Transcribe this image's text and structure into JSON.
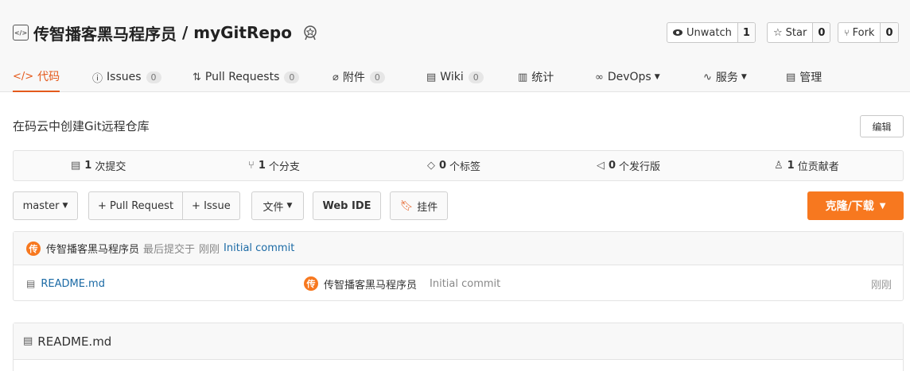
{
  "repo": {
    "owner": "传智播客黑马程序员",
    "separator": " / ",
    "name": "myGitRepo",
    "icon": "repo-code-icon"
  },
  "actions": {
    "unwatch": {
      "label": "Unwatch",
      "count": "1"
    },
    "star": {
      "label": "Star",
      "count": "0"
    },
    "fork": {
      "label": "Fork",
      "count": "0"
    }
  },
  "nav": {
    "code": "代码",
    "issues": {
      "label": "Issues",
      "count": "0"
    },
    "pulls": {
      "label": "Pull Requests",
      "count": "0"
    },
    "attach": {
      "label": "附件",
      "count": "0"
    },
    "wiki": {
      "label": "Wiki",
      "count": "0"
    },
    "stats": "统计",
    "devops": "DevOps",
    "service": "服务",
    "manage": "管理"
  },
  "description": "在码云中创建Git远程仓库",
  "edit_label": "编辑",
  "stats": {
    "commits": {
      "num": "1",
      "label": "次提交"
    },
    "branches": {
      "num": "1",
      "label": "个分支"
    },
    "tags": {
      "num": "0",
      "label": "个标签"
    },
    "releases": {
      "num": "0",
      "label": "个发行版"
    },
    "contributors": {
      "num": "1",
      "label": "位贡献者"
    }
  },
  "toolbar": {
    "branch": "master",
    "pull_request": "+ Pull Request",
    "issue": "+ Issue",
    "file": "文件",
    "web_ide": "Web IDE",
    "widget": "挂件",
    "clone": "克隆/下载"
  },
  "last_commit": {
    "avatar": "传",
    "author": "传智播客黑马程序员",
    "prefix": "最后提交于",
    "time": "刚刚",
    "message": "Initial commit"
  },
  "files": [
    {
      "name": "README.md",
      "avatar": "传",
      "author": "传智播客黑马程序员",
      "message": "Initial commit",
      "time": "刚刚"
    }
  ],
  "readme": {
    "title": "README.md"
  },
  "colors": {
    "accent": "#e45a1c",
    "clone_button": "#f7781f",
    "link": "#1b6aa5"
  }
}
